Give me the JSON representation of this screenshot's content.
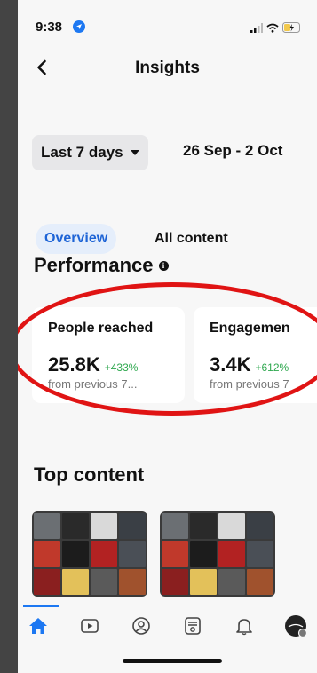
{
  "status_bar": {
    "time": "9:38"
  },
  "header": {
    "title": "Insights"
  },
  "filters": {
    "range_label": "Last 7 days",
    "date_range": "26 Sep - 2 Oct"
  },
  "tabs": [
    {
      "label": "Overview",
      "active": true
    },
    {
      "label": "All content",
      "active": false
    }
  ],
  "performance": {
    "title": "Performance",
    "cards": [
      {
        "label": "People reached",
        "value": "25.8K",
        "change": "+433%",
        "sub": "from previous 7..."
      },
      {
        "label": "Engagemen",
        "value": "3.4K",
        "change": "+612%",
        "sub": "from previous 7"
      }
    ]
  },
  "top_content": {
    "title": "Top content",
    "thumbnails": [
      {
        "icon": "car-grid-image"
      },
      {
        "icon": "car-grid-image"
      }
    ]
  },
  "bottom_nav": [
    {
      "icon": "home-icon",
      "active": true
    },
    {
      "icon": "video-icon",
      "active": false
    },
    {
      "icon": "profile-icon",
      "active": false
    },
    {
      "icon": "feed-icon",
      "active": false
    },
    {
      "icon": "bell-icon",
      "active": false
    },
    {
      "icon": "avatar",
      "active": false
    }
  ],
  "colors": {
    "accent": "#1d78f2",
    "positive": "#2fa84f",
    "annotation": "#e01414",
    "background": "#f7f7f7"
  }
}
